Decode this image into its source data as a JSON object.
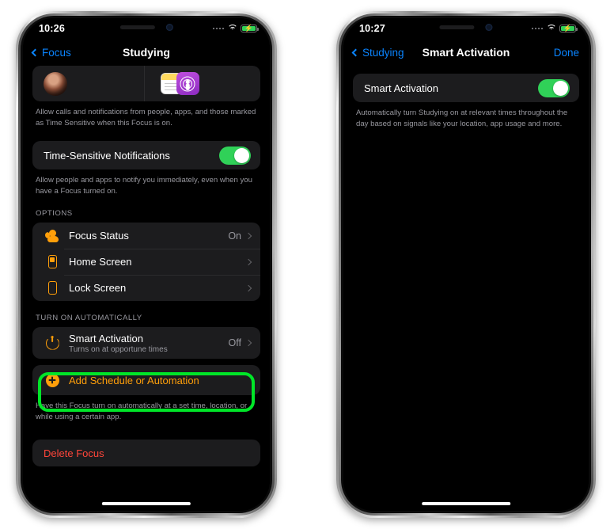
{
  "phones": [
    {
      "id": "left",
      "status_bar": {
        "time": "10:26",
        "cellular_icon": "cellular-dots-icon",
        "wifi_icon": "wifi-icon",
        "battery_icon": "battery-charging-icon"
      },
      "nav": {
        "back_label": "Focus",
        "title": "Studying",
        "right_label": ""
      },
      "people_apps_row": {
        "people_icon": "contact-avatar",
        "apps_icons": [
          "notes-app-icon",
          "podcasts-app-icon"
        ]
      },
      "footnote_allow": "Allow calls and notifications from people, apps, and those marked as Time Sensitive when this Focus is on.",
      "time_sensitive": {
        "label": "Time-Sensitive Notifications",
        "toggle_on": true
      },
      "footnote_time_sensitive": "Allow people and apps to notify you immediately, even when you have a Focus turned on.",
      "options_header": "OPTIONS",
      "options_rows": [
        {
          "label": "Focus Status",
          "value": "On",
          "icon": "focus-status-icon"
        },
        {
          "label": "Home Screen",
          "value": "",
          "icon": "home-screen-icon"
        },
        {
          "label": "Lock Screen",
          "value": "",
          "icon": "lock-screen-icon"
        }
      ],
      "auto_header": "TURN ON AUTOMATICALLY",
      "smart_activation_row": {
        "label": "Smart Activation",
        "sublabel": "Turns on at opportune times",
        "value": "Off",
        "icon": "power-icon"
      },
      "add_schedule_row": {
        "label": "Add Schedule or Automation",
        "icon": "plus-circle-icon"
      },
      "footnote_schedule": "Have this Focus turn on automatically at a set time, location, or while using a certain app.",
      "delete_row": {
        "label": "Delete Focus"
      },
      "highlight_color": "#00e528"
    },
    {
      "id": "right",
      "status_bar": {
        "time": "10:27",
        "cellular_icon": "cellular-dots-icon",
        "wifi_icon": "wifi-icon",
        "battery_icon": "battery-charging-icon"
      },
      "nav": {
        "back_label": "Studying",
        "title": "Smart Activation",
        "right_label": "Done"
      },
      "smart_activation": {
        "label": "Smart Activation",
        "toggle_on": true
      },
      "footnote": "Automatically turn Studying on at relevant times throughout the day based on signals like your location, app usage and more."
    }
  ]
}
